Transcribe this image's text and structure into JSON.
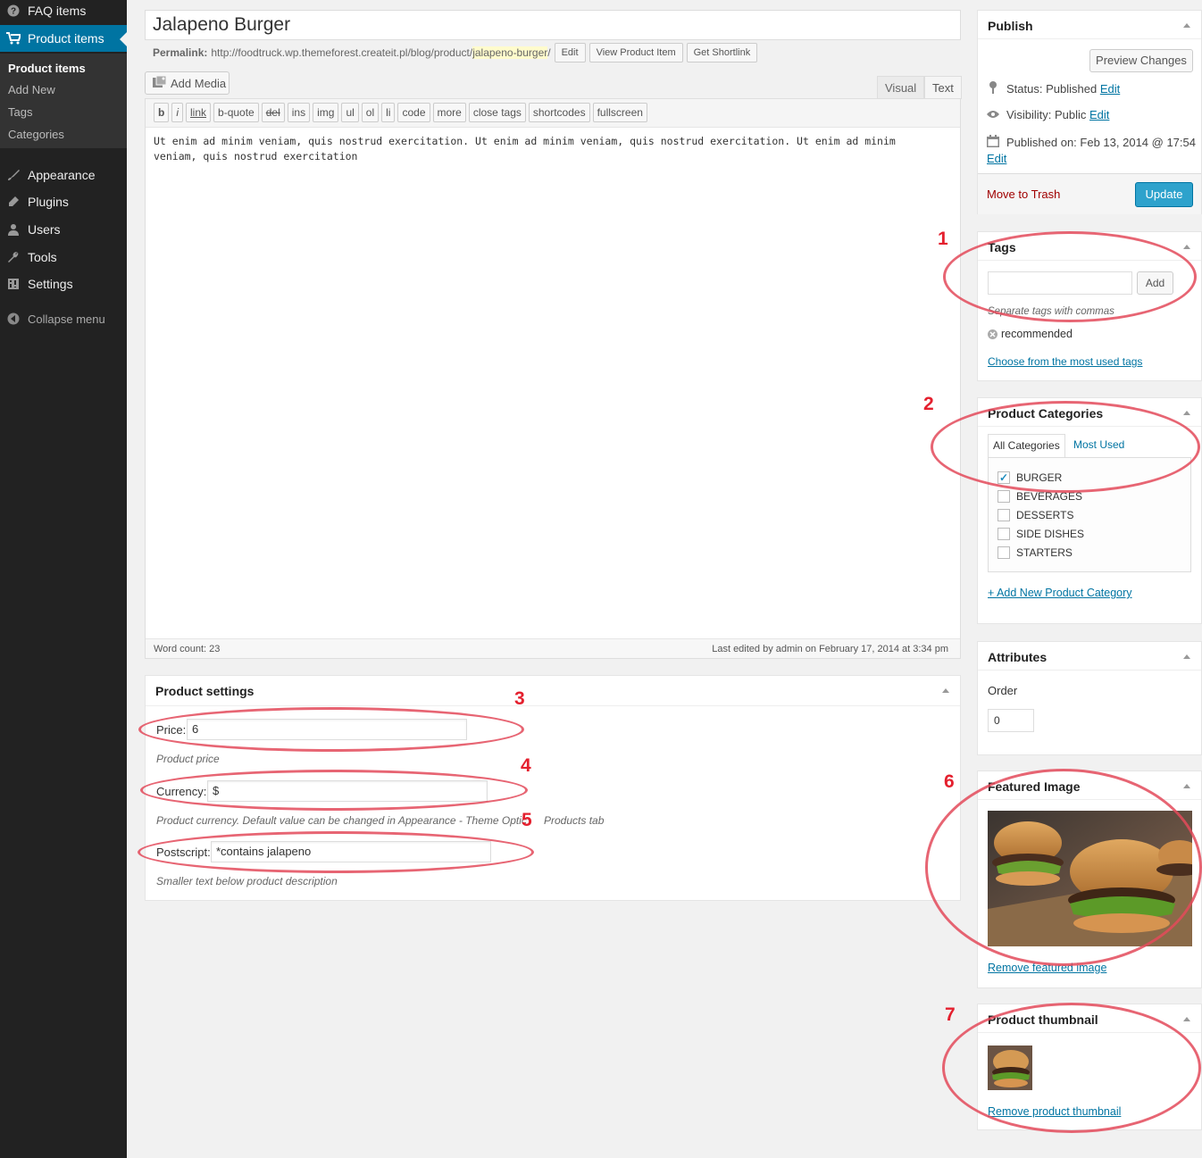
{
  "sidebar": {
    "items": [
      {
        "label": "FAQ items",
        "icon": "help-icon"
      },
      {
        "label": "Product items",
        "icon": "cart-icon"
      },
      {
        "label": "Appearance",
        "icon": "paintbrush-icon"
      },
      {
        "label": "Plugins",
        "icon": "plugin-icon"
      },
      {
        "label": "Users",
        "icon": "users-icon"
      },
      {
        "label": "Tools",
        "icon": "wrench-icon"
      },
      {
        "label": "Settings",
        "icon": "settings-icon"
      }
    ],
    "submenu": [
      "Product items",
      "Add New",
      "Tags",
      "Categories"
    ],
    "collapse_label": "Collapse menu"
  },
  "post": {
    "title": "Jalapeno Burger",
    "permalink_label": "Permalink:",
    "permalink_base": "http://foodtruck.wp.themeforest.createit.pl/blog/product/",
    "permalink_slug": "jalapeno-burger",
    "permalink_end": "/",
    "permalink_buttons": [
      "Edit",
      "View Product Item",
      "Get Shortlink"
    ]
  },
  "editor": {
    "add_media": "Add Media",
    "tabs": [
      "Visual",
      "Text"
    ],
    "quicktags": [
      "b",
      "i",
      "link",
      "b-quote",
      "del",
      "ins",
      "img",
      "ul",
      "ol",
      "li",
      "code",
      "more",
      "close tags",
      "shortcodes",
      "fullscreen"
    ],
    "content": "Ut enim ad minim veniam, quis nostrud exercitation. Ut enim ad minim veniam, quis nostrud exercitation. Ut enim ad minim veniam, quis nostrud exercitation",
    "word_count": "Word count: 23",
    "last_edited": "Last edited by admin on February 17, 2014 at 3:34 pm"
  },
  "product_settings": {
    "title": "Product settings",
    "price_label": "Price:",
    "price_value": "6",
    "price_desc": "Product price",
    "currency_label": "Currency:",
    "currency_value": "$",
    "currency_desc": "Product currency. Default value can be changed in Appearance - Theme Optic",
    "currency_desc_tail": "Products tab",
    "postscript_label": "Postscript:",
    "postscript_value": "*contains jalapeno",
    "postscript_desc": "Smaller text below product description"
  },
  "publish": {
    "title": "Publish",
    "preview_button": "Preview Changes",
    "status_label": "Status:",
    "status_value": "Published",
    "visibility_label": "Visibility:",
    "visibility_value": "Public",
    "published_label": "Published on:",
    "published_value": "Feb 13, 2014 @ 17:54",
    "edit_link": "Edit",
    "trash_link": "Move to Trash",
    "update_button": "Update"
  },
  "tags_box": {
    "title": "Tags",
    "add_button": "Add",
    "hint": "Separate tags with commas",
    "tag": "recommended",
    "choose_link": "Choose from the most used tags"
  },
  "categories_box": {
    "title": "Product Categories",
    "tabs": [
      "All Categories",
      "Most Used"
    ],
    "items": [
      {
        "label": "BURGER",
        "checked": true
      },
      {
        "label": "BEVERAGES",
        "checked": false
      },
      {
        "label": "DESSERTS",
        "checked": false
      },
      {
        "label": "SIDE DISHES",
        "checked": false
      },
      {
        "label": "STARTERS",
        "checked": false
      }
    ],
    "add_link": "+ Add New Product Category"
  },
  "attributes_box": {
    "title": "Attributes",
    "order_label": "Order",
    "order_value": "0"
  },
  "featured_box": {
    "title": "Featured Image",
    "remove_link": "Remove featured image"
  },
  "thumbnail_box": {
    "title": "Product thumbnail",
    "remove_link": "Remove product thumbnail"
  },
  "annotations": [
    "1",
    "2",
    "3",
    "4",
    "5",
    "6",
    "7"
  ],
  "colors": {
    "sidebar_bg": "#222222",
    "accent": "#0074a2",
    "primary_button": "#2ea2cc",
    "annotation_red": "#e34a5a",
    "trash_red": "#a00000"
  }
}
